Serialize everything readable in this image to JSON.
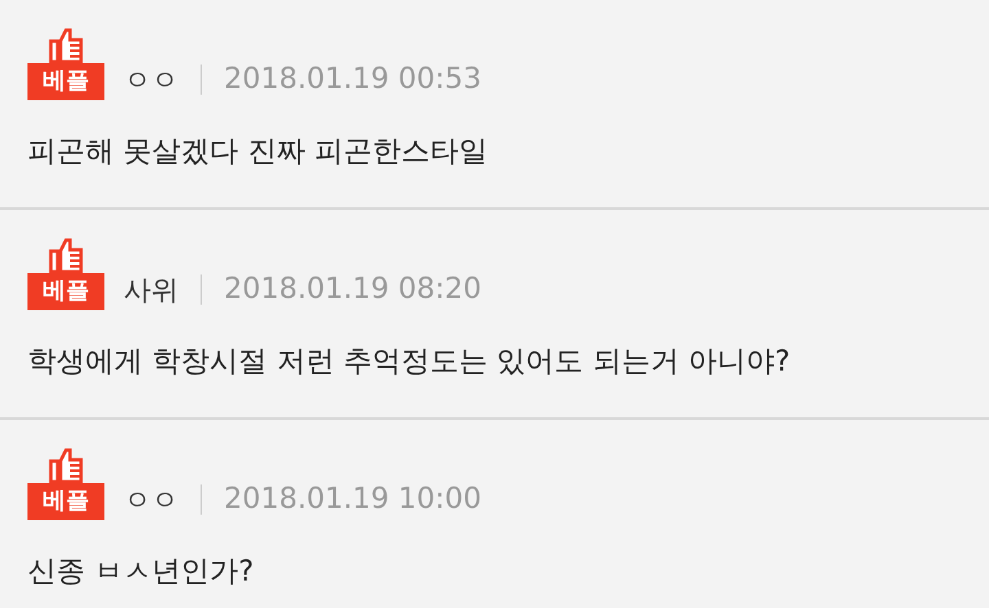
{
  "comments": [
    {
      "badge": "베플",
      "author": "ㅇㅇ",
      "date": "2018.01.19 00:53",
      "text": "피곤해 못살겠다 진짜 피곤한스타일"
    },
    {
      "badge": "베플",
      "author": "사위",
      "date": "2018.01.19 08:20",
      "text": "학생에게 학창시절 저런 추억정도는 있어도 되는거 아니야?"
    },
    {
      "badge": "베플",
      "author": "ㅇㅇ",
      "date": "2018.01.19 10:00",
      "text": "신종 ㅂㅅ년인가?"
    }
  ]
}
